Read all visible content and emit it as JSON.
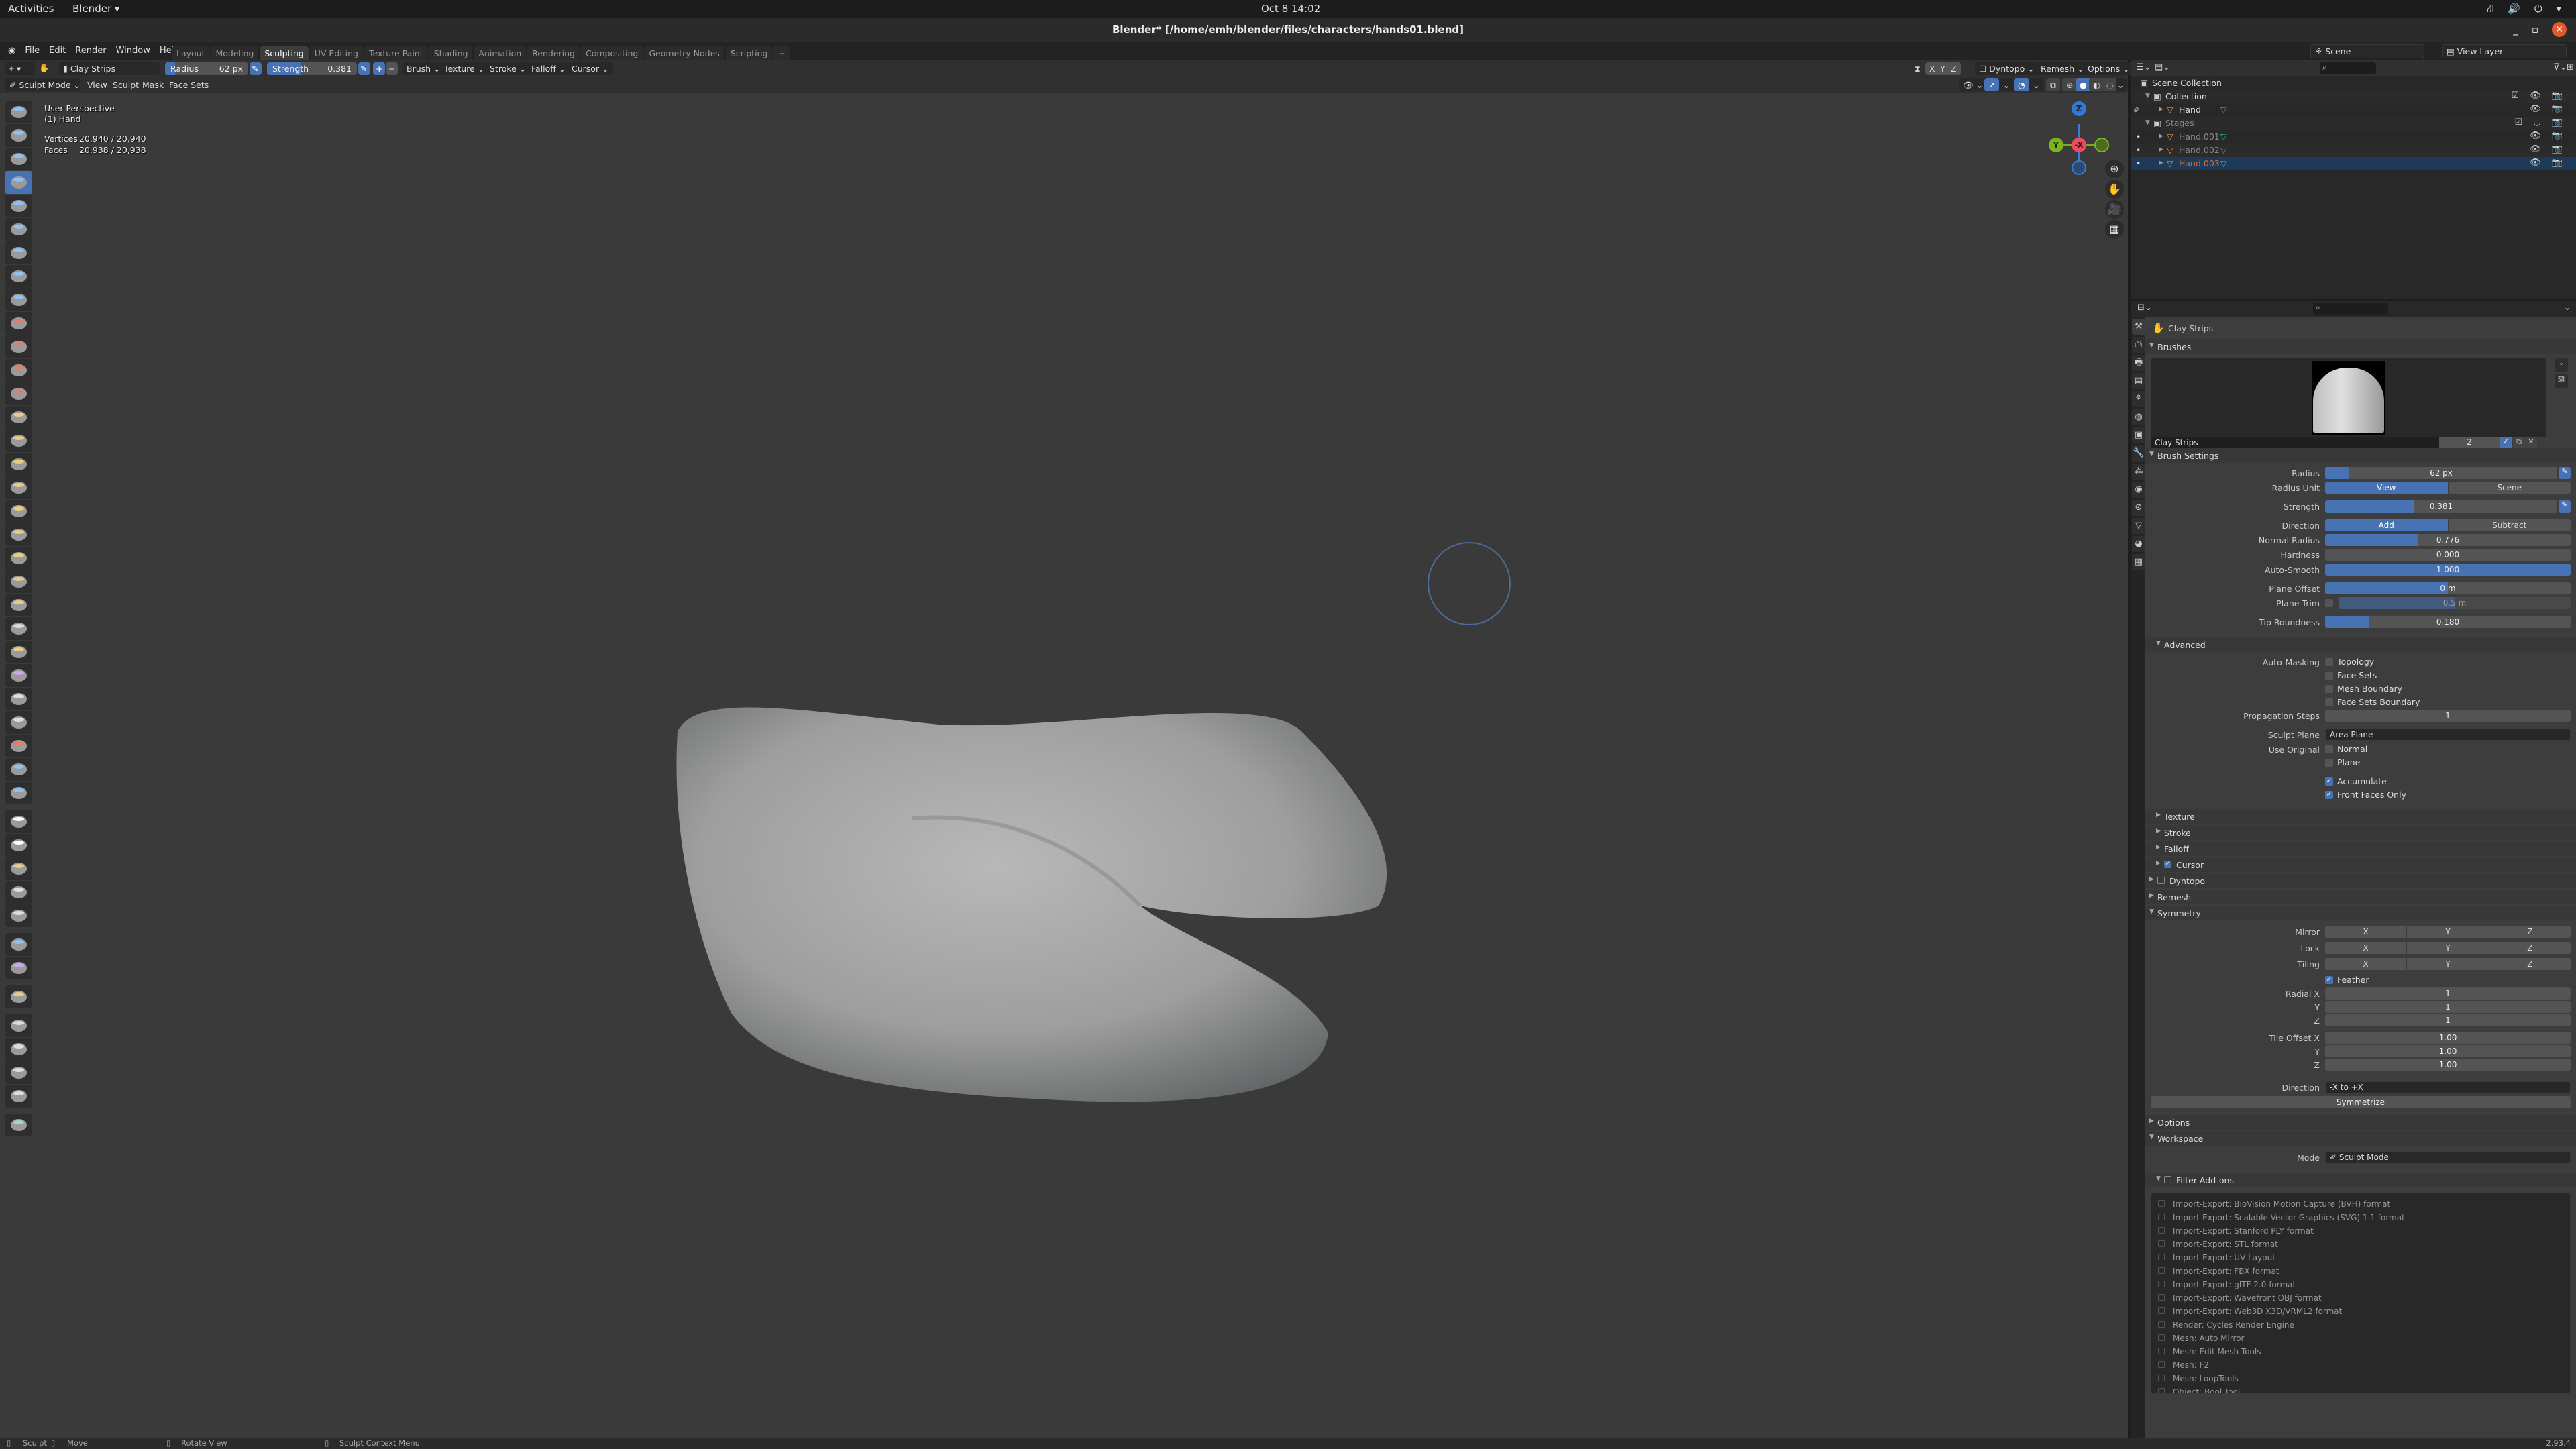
{
  "gnome": {
    "activities": "Activities",
    "app": "Blender ▾",
    "clock": "Oct 8  14:02",
    "tray": "⛙ 🔊 ⏻ ▾"
  },
  "window": {
    "title": "Blender* [/home/emh/blender/files/characters/hands01.blend]",
    "minimize": "_",
    "maximize": "▫",
    "close": "✕"
  },
  "menubar": {
    "items": [
      "File",
      "Edit",
      "Render",
      "Window",
      "Help"
    ],
    "tabs": [
      {
        "label": "Layout",
        "active": false
      },
      {
        "label": "Modeling",
        "active": false
      },
      {
        "label": "Sculpting",
        "active": true
      },
      {
        "label": "UV Editing",
        "active": false
      },
      {
        "label": "Texture Paint",
        "active": false
      },
      {
        "label": "Shading",
        "active": false
      },
      {
        "label": "Animation",
        "active": false
      },
      {
        "label": "Rendering",
        "active": false
      },
      {
        "label": "Compositing",
        "active": false
      },
      {
        "label": "Geometry Nodes",
        "active": false
      },
      {
        "label": "Scripting",
        "active": false
      },
      {
        "label": "+",
        "active": false
      }
    ],
    "scene": "Scene",
    "view_layer": "View Layer"
  },
  "tool_header": {
    "brush_name": "Clay Strips",
    "radius": {
      "label": "Radius",
      "value": "62 px",
      "fraction": 0.12
    },
    "strength": {
      "label": "Strength",
      "value": "0.381",
      "fraction": 0.381
    },
    "plus": "+",
    "minus": "−",
    "menus": [
      "Brush",
      "Texture",
      "Stroke",
      "Falloff",
      "Cursor"
    ],
    "axes": [
      "X",
      "Y",
      "Z"
    ],
    "dyntopo": "Dyntopo",
    "remesh": "Remesh",
    "options": "Options"
  },
  "mode_header": {
    "mode": "Sculpt Mode",
    "menus": [
      "View",
      "Sculpt",
      "Mask",
      "Face Sets"
    ]
  },
  "viewport": {
    "view_name": "User Perspective",
    "object": "(1) Hand",
    "stats": [
      {
        "label": "Vertices",
        "value": "20,940 / 20,940"
      },
      {
        "label": "Faces",
        "value": "20,938 / 20,938"
      }
    ],
    "gizmo": {
      "z": "Z",
      "y": "Y",
      "x": "-X"
    }
  },
  "outliner": {
    "rows": [
      {
        "name": "Scene Collection",
        "type": "scene",
        "indent": 0
      },
      {
        "name": "Collection",
        "type": "collection",
        "indent": 1,
        "checked": true
      },
      {
        "name": "Hand",
        "type": "mesh",
        "indent": 2,
        "active": true
      },
      {
        "name": "Stages",
        "type": "collection",
        "indent": 1,
        "checked": true,
        "dim": true
      },
      {
        "name": "Hand.001",
        "type": "mesh",
        "indent": 2,
        "dim": true
      },
      {
        "name": "Hand.002",
        "type": "mesh",
        "indent": 2,
        "dim": true
      },
      {
        "name": "Hand.003",
        "type": "mesh",
        "indent": 2,
        "dim": true,
        "selected": true
      }
    ]
  },
  "properties": {
    "title": "Clay Strips",
    "brushes": {
      "label": "Brushes",
      "name": "Clay Strips",
      "users": "2"
    },
    "brush_settings": {
      "label": "Brush Settings",
      "radius": {
        "label": "Radius",
        "value": "62 px",
        "fraction": 0.1
      },
      "radius_unit": {
        "label": "Radius Unit",
        "options": [
          "View",
          "Scene"
        ],
        "selected": "View"
      },
      "strength": {
        "label": "Strength",
        "value": "0.381",
        "fraction": 0.381
      },
      "direction": {
        "label": "Direction",
        "options": [
          "Add",
          "Subtract"
        ],
        "selected": "Add"
      },
      "normal_radius": {
        "label": "Normal Radius",
        "value": "0.776",
        "fraction": 0.38
      },
      "hardness": {
        "label": "Hardness",
        "value": "0.000",
        "fraction": 0
      },
      "auto_smooth": {
        "label": "Auto-Smooth",
        "value": "1.000",
        "fraction": 1.0
      },
      "plane_offset": {
        "label": "Plane Offset",
        "value": "0 m",
        "fraction": 0.5
      },
      "plane_trim": {
        "label": "Plane Trim",
        "value": "0.5 m",
        "fraction": 0.5,
        "enabled": false
      },
      "tip_roundness": {
        "label": "Tip Roundness",
        "value": "0.180",
        "fraction": 0.18
      }
    },
    "advanced": {
      "label": "Advanced",
      "auto_masking_label": "Auto-Masking",
      "auto_masking": [
        {
          "label": "Topology",
          "checked": false
        },
        {
          "label": "Face Sets",
          "checked": false
        },
        {
          "label": "Mesh Boundary",
          "checked": false
        },
        {
          "label": "Face Sets Boundary",
          "checked": false
        }
      ],
      "propagation": {
        "label": "Propagation Steps",
        "value": "1"
      },
      "sculpt_plane": {
        "label": "Sculpt Plane",
        "value": "Area Plane"
      },
      "use_original_label": "Use Original",
      "use_original": [
        {
          "label": "Normal",
          "checked": false
        },
        {
          "label": "Plane",
          "checked": false
        }
      ],
      "accumulate": {
        "label": "Accumulate",
        "checked": true
      },
      "front_faces": {
        "label": "Front Faces Only",
        "checked": true
      }
    },
    "subpanels": [
      {
        "label": "Texture"
      },
      {
        "label": "Stroke"
      },
      {
        "label": "Falloff"
      },
      {
        "label": "Cursor",
        "checked": true
      }
    ],
    "dyntopo": {
      "label": "Dyntopo",
      "checked": false
    },
    "remesh": {
      "label": "Remesh"
    },
    "symmetry": {
      "label": "Symmetry",
      "mirror": {
        "label": "Mirror",
        "axes": [
          "X",
          "Y",
          "Z"
        ]
      },
      "lock": {
        "label": "Lock",
        "axes": [
          "X",
          "Y",
          "Z"
        ]
      },
      "tiling": {
        "label": "Tiling",
        "axes": [
          "X",
          "Y",
          "Z"
        ]
      },
      "feather": {
        "label": "Feather",
        "checked": true
      },
      "radial": [
        {
          "label": "Radial X",
          "value": "1"
        },
        {
          "label": "Y",
          "value": "1"
        },
        {
          "label": "Z",
          "value": "1"
        }
      ],
      "tile_offset": [
        {
          "label": "Tile Offset X",
          "value": "1.00"
        },
        {
          "label": "Y",
          "value": "1.00"
        },
        {
          "label": "Z",
          "value": "1.00"
        }
      ],
      "direction": {
        "label": "Direction",
        "value": "-X to +X"
      },
      "symmetrize": "Symmetrize"
    },
    "options": {
      "label": "Options"
    },
    "workspace": {
      "label": "Workspace",
      "mode_label": "Mode",
      "mode": "Sculpt Mode"
    },
    "filter_addons": {
      "label": "Filter Add-ons",
      "checked": false,
      "addons": [
        "Import-Export: BioVision Motion Capture (BVH) format",
        "Import-Export: Scalable Vector Graphics (SVG) 1.1 format",
        "Import-Export: Stanford PLY format",
        "Import-Export: STL format",
        "Import-Export: UV Layout",
        "Import-Export: FBX format",
        "Import-Export: glTF 2.0 format",
        "Import-Export: Wavefront OBJ format",
        "Import-Export: Web3D X3D/VRML2 format",
        "Render: Cycles Render Engine",
        "Mesh: Auto Mirror",
        "Mesh: Edit Mesh Tools",
        "Mesh: F2",
        "Mesh: LoopTools",
        "Object: Bool Tool"
      ]
    }
  },
  "statusbar": {
    "items": [
      "Sculpt",
      "Move",
      "Rotate View",
      "Sculpt Context Menu"
    ],
    "version": "2.93.4"
  },
  "colors": {
    "accent": "#4772b3",
    "selected_row": "#1f3959",
    "mesh_orange": "#e8923d",
    "data_green": "#1fbf8f"
  }
}
